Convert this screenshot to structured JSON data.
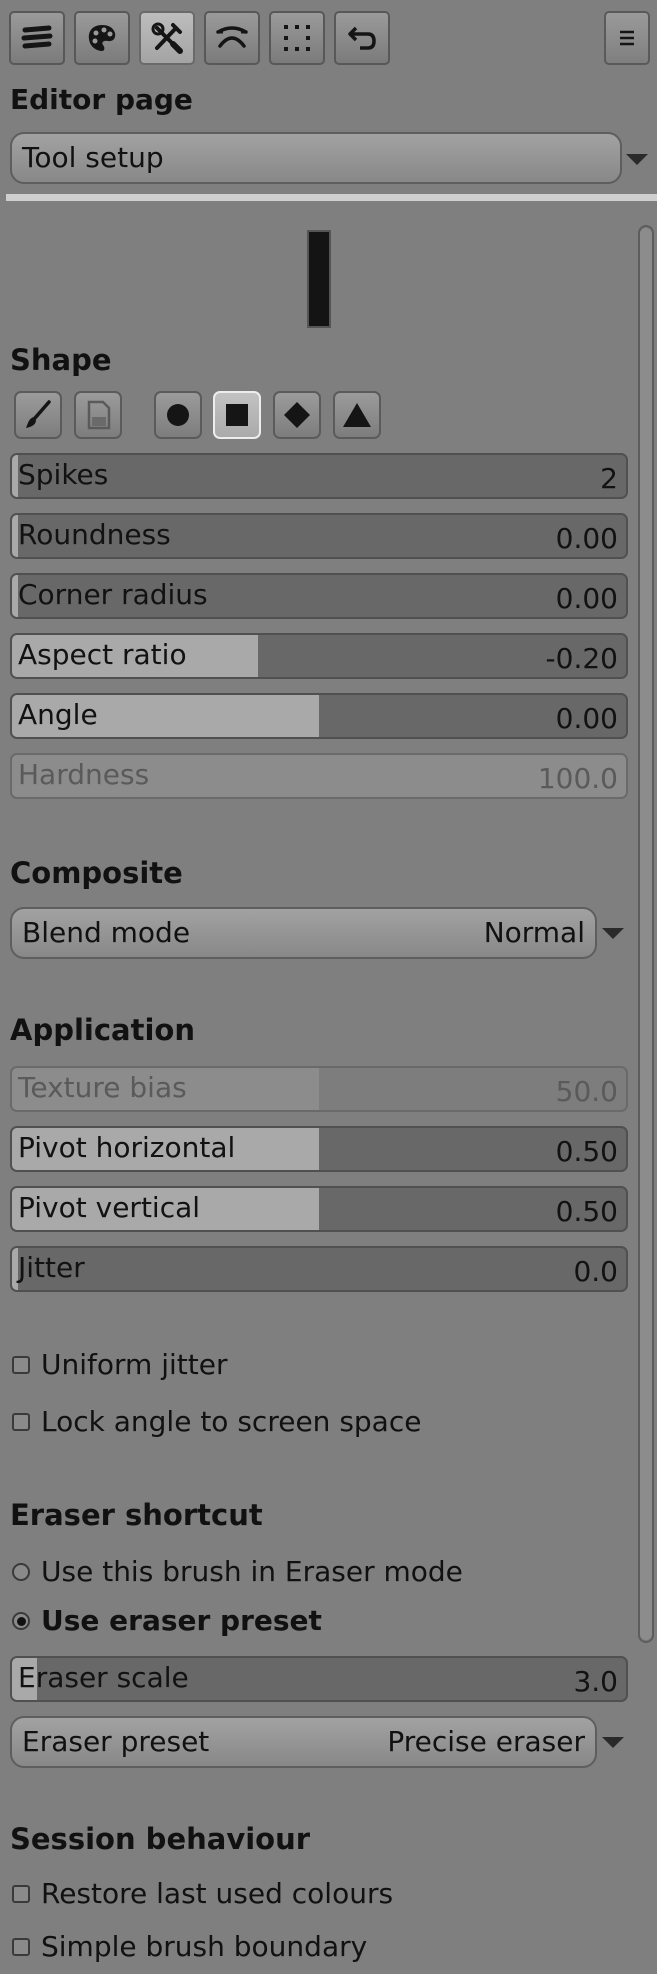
{
  "tabs": [
    {
      "name": "layers-icon",
      "active": false
    },
    {
      "name": "palette-icon",
      "active": false
    },
    {
      "name": "tools-icon",
      "active": true
    },
    {
      "name": "curve-icon",
      "active": false
    },
    {
      "name": "selection-icon",
      "active": false
    },
    {
      "name": "undo-icon",
      "active": false
    }
  ],
  "menu_icon": "hamburger-menu-icon",
  "editor": {
    "label": "Editor page",
    "page_value": "Tool setup"
  },
  "shape": {
    "title": "Shape",
    "buttons": [
      {
        "name": "brush-shape-icon",
        "active": false
      },
      {
        "name": "stamp-file-icon",
        "active": false
      },
      {
        "name": "circle-shape-icon",
        "active": false
      },
      {
        "name": "square-shape-icon",
        "active": true
      },
      {
        "name": "diamond-shape-icon",
        "active": false
      },
      {
        "name": "triangle-shape-icon",
        "active": false
      }
    ],
    "sliders": {
      "spikes": {
        "label": "Spikes",
        "value": "2",
        "fill": 0.0
      },
      "roundness": {
        "label": "Roundness",
        "value": "0.00",
        "fill": 0.0
      },
      "corner_radius": {
        "label": "Corner radius",
        "value": "0.00",
        "fill": 0.0
      },
      "aspect_ratio": {
        "label": "Aspect ratio",
        "value": "-0.20",
        "fill": 0.4
      },
      "angle": {
        "label": "Angle",
        "value": "0.00",
        "fill": 0.5
      },
      "hardness": {
        "label": "Hardness",
        "value": "100.0",
        "fill": 1.0,
        "disabled": true
      }
    }
  },
  "composite": {
    "title": "Composite",
    "blend_label": "Blend mode",
    "blend_value": "Normal"
  },
  "application": {
    "title": "Application",
    "sliders": {
      "texture_bias": {
        "label": "Texture bias",
        "value": "50.0",
        "fill": 0.5,
        "disabled": true
      },
      "pivot_h": {
        "label": "Pivot horizontal",
        "value": "0.50",
        "fill": 0.5
      },
      "pivot_v": {
        "label": "Pivot vertical",
        "value": "0.50",
        "fill": 0.5
      },
      "jitter": {
        "label": "Jitter",
        "value": "0.0",
        "fill": 0.0
      }
    },
    "uniform_jitter": "Uniform jitter",
    "lock_angle": "Lock angle to screen space"
  },
  "eraser": {
    "title": "Eraser shortcut",
    "radio_brush": "Use this brush in Eraser mode",
    "radio_preset": "Use eraser preset",
    "scale": {
      "label": "Eraser scale",
      "value": "3.0",
      "fill": 0.04
    },
    "preset_label": "Eraser preset",
    "preset_value": "Precise eraser"
  },
  "session": {
    "title": "Session behaviour",
    "restore_colours": "Restore last used colours",
    "simple_boundary": "Simple brush boundary"
  }
}
